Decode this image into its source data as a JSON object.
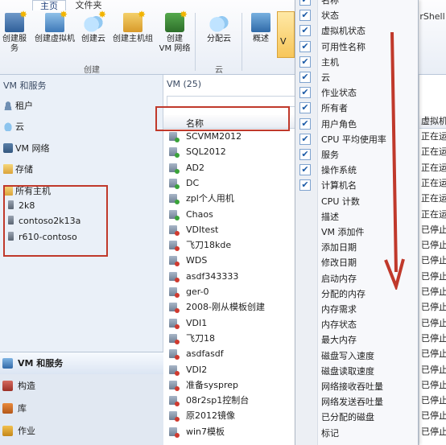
{
  "ribbon": {
    "tabs": [
      "主页",
      "文件夹"
    ],
    "extra_tab": "rShell",
    "buttons": {
      "create_service": "创建服务",
      "create_vm": "创建虚拟机",
      "create_cloud": "创建云",
      "create_host_group": "创建主机组",
      "create_vm_network_line1": "创建",
      "create_vm_network_line2": "VM 网络",
      "assign_cloud": "分配云",
      "overview": "概述",
      "vm_active": "V"
    },
    "groups": {
      "create": "创建",
      "cloud": "云"
    }
  },
  "nav": {
    "title": "VM 和服务",
    "items": [
      "租户",
      "云",
      "VM 网络",
      "存储",
      "所有主机"
    ],
    "hosts": [
      "2k8",
      "contoso2k13a",
      "r610-contoso"
    ]
  },
  "wunderbar": [
    "VM 和服务",
    "构造",
    "库",
    "作业"
  ],
  "main": {
    "title": "VM (25)",
    "column_name": "名称",
    "rows": [
      {
        "name": "SCVMM2012",
        "status": "正在运",
        "state": "run"
      },
      {
        "name": "SQL2012",
        "status": "正在运",
        "state": "run"
      },
      {
        "name": "AD2",
        "status": "正在运",
        "state": "run"
      },
      {
        "name": "DC",
        "status": "正在运",
        "state": "run"
      },
      {
        "name": "zpl个人用机",
        "status": "正在运",
        "state": "run"
      },
      {
        "name": "Chaos",
        "status": "正在运",
        "state": "run"
      },
      {
        "name": "VDItest",
        "status": "已停止",
        "state": "stop"
      },
      {
        "name": "飞刀18kde",
        "status": "已停止",
        "state": "stop"
      },
      {
        "name": "WDS",
        "status": "已停止",
        "state": "stop"
      },
      {
        "name": "asdf343333",
        "status": "已停止",
        "state": "stop"
      },
      {
        "name": "ger-0",
        "status": "已停止",
        "state": "stop"
      },
      {
        "name": "2008-刚从模板创建",
        "status": "已停止",
        "state": "stop"
      },
      {
        "name": "VDI1",
        "status": "已停止",
        "state": "stop"
      },
      {
        "name": "飞刀18",
        "status": "已停止",
        "state": "stop"
      },
      {
        "name": "asdfasdf",
        "status": "已停止",
        "state": "stop"
      },
      {
        "name": "VDI2",
        "status": "已停止",
        "state": "stop"
      },
      {
        "name": "准备sysprep",
        "status": "已停止",
        "state": "stop"
      },
      {
        "name": "08r2sp1控制台",
        "status": "已停止",
        "state": "stop"
      },
      {
        "name": "原2012镜像",
        "status": "已停止",
        "state": "stop"
      },
      {
        "name": "win7模板",
        "status": "已停止",
        "state": "stop"
      }
    ]
  },
  "right_header": "虚拟机",
  "menu": {
    "items": [
      {
        "label": "名称",
        "checked": true
      },
      {
        "label": "状态",
        "checked": true
      },
      {
        "label": "虚拟机状态",
        "checked": true
      },
      {
        "label": "可用性名称",
        "checked": true
      },
      {
        "label": "主机",
        "checked": true
      },
      {
        "label": "云",
        "checked": true
      },
      {
        "label": "作业状态",
        "checked": true
      },
      {
        "label": "所有者",
        "checked": true
      },
      {
        "label": "用户角色",
        "checked": true
      },
      {
        "label": "CPU 平均使用率",
        "checked": true
      },
      {
        "label": "服务",
        "checked": true
      },
      {
        "label": "操作系统",
        "checked": true
      },
      {
        "label": "计算机名",
        "checked": true
      },
      {
        "label": "CPU 计数",
        "checked": false
      },
      {
        "label": "描述",
        "checked": false
      },
      {
        "label": "VM 添加件",
        "checked": false
      },
      {
        "label": "添加日期",
        "checked": false
      },
      {
        "label": "修改日期",
        "checked": false
      },
      {
        "label": "启动内存",
        "checked": false
      },
      {
        "label": "分配的内存",
        "checked": false
      },
      {
        "label": "内存需求",
        "checked": false
      },
      {
        "label": "内存状态",
        "checked": false
      },
      {
        "label": "最大内存",
        "checked": false
      },
      {
        "label": "磁盘写入速度",
        "checked": false
      },
      {
        "label": "磁盘读取速度",
        "checked": false
      },
      {
        "label": "网络接收吞吐量",
        "checked": false
      },
      {
        "label": "网络发送吞吐量",
        "checked": false
      },
      {
        "label": "已分配的磁盘",
        "checked": false
      },
      {
        "label": "标记",
        "checked": false
      }
    ]
  },
  "colors": {
    "annotation": "#c0392b",
    "check": "#1b5aa6"
  }
}
